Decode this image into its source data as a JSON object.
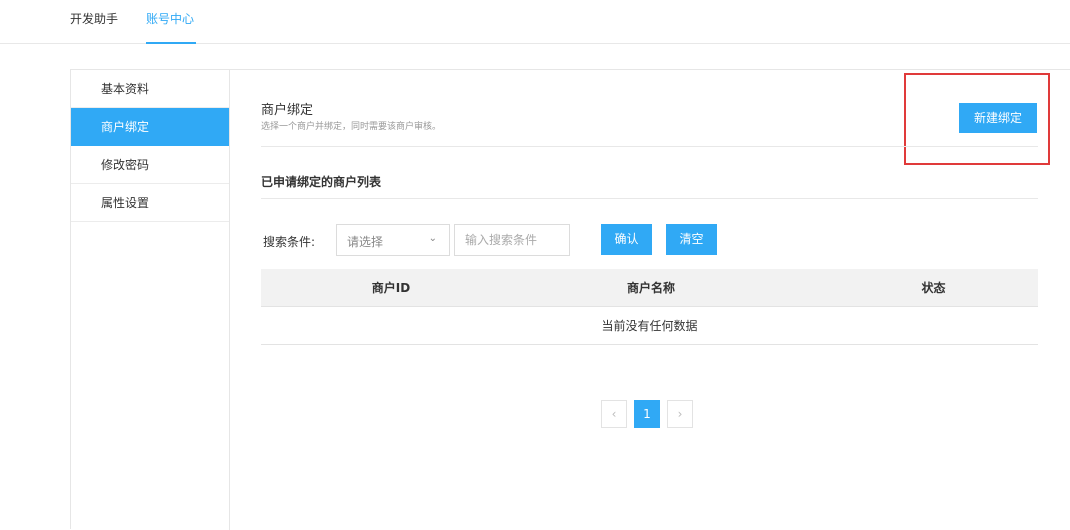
{
  "topnav": {
    "tabs": [
      {
        "label": "开发助手"
      },
      {
        "label": "账号中心"
      }
    ],
    "active_color": "#30a9f5"
  },
  "sidebar": {
    "items": [
      {
        "label": "基本资料"
      },
      {
        "label": "商户绑定"
      },
      {
        "label": "修改密码"
      },
      {
        "label": "属性设置"
      }
    ],
    "active_index": 1
  },
  "main": {
    "title": "商户绑定",
    "description": "选择一个商户并绑定，同时需要该商户审核。",
    "new_button_label": "新建绑定",
    "list_title": "已申请绑定的商户列表",
    "search": {
      "label": "搜索条件:",
      "select_value": "请选择",
      "input_placeholder": "输入搜索条件",
      "confirm_label": "确认",
      "clear_label": "清空"
    },
    "table": {
      "columns": [
        "商户ID",
        "商户名称",
        "状态"
      ],
      "empty_text": "当前没有任何数据"
    },
    "pagination": {
      "prev": "‹",
      "current": "1",
      "next": "›"
    }
  },
  "colors": {
    "primary": "#30a9f5",
    "highlight": "#e03a3a"
  }
}
